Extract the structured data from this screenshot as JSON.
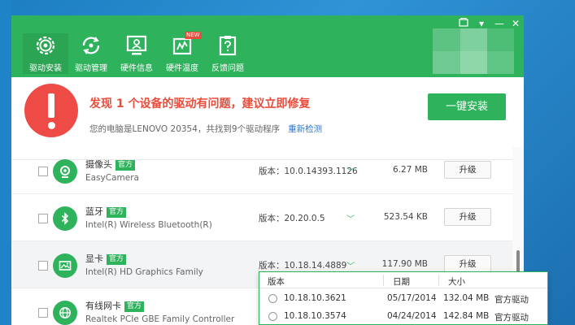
{
  "nav": [
    {
      "label": "驱动安装",
      "icon": "gear-icon"
    },
    {
      "label": "驱动管理",
      "icon": "refresh-icon"
    },
    {
      "label": "硬件信息",
      "icon": "monitor-icon"
    },
    {
      "label": "硬件温度",
      "icon": "thermometer-icon",
      "badge": "NEW"
    },
    {
      "label": "反馈问题",
      "icon": "feedback-icon"
    }
  ],
  "titlebar": {
    "menu_icon": "▾",
    "minimize": "—",
    "close": "✕"
  },
  "alert": {
    "title": "发现 1 个设备的驱动有问题，建议立即修复",
    "subtitle": "您的电脑是LENOVO 20354，共找到9个驱动程序",
    "rescan": "重新检测",
    "install_button": "一键安装"
  },
  "devices": [
    {
      "name": "摄像头",
      "tag": "官方",
      "model": "EasyCamera",
      "version": "版本：10.0.14393.1126",
      "size": "6.27 MB",
      "action": "升级",
      "icon": "camera-icon"
    },
    {
      "name": "蓝牙",
      "tag": "官方",
      "model": "Intel(R) Wireless Bluetooth(R)",
      "version": "版本：20.20.0.5",
      "size": "523.54 KB",
      "action": "升级",
      "icon": "bluetooth-icon"
    },
    {
      "name": "显卡",
      "tag": "官方",
      "model": "Intel(R) HD Graphics Family",
      "version": "版本：10.18.14.4889",
      "size": "117.90 MB",
      "action": "升级",
      "icon": "display-card-icon"
    },
    {
      "name": "有线网卡",
      "tag": "官方",
      "model": "Realtek PCIe GBE Family Controller",
      "version": "",
      "size": "",
      "action": "",
      "icon": "globe-icon"
    }
  ],
  "dropdown": {
    "headers": {
      "version": "版本",
      "date": "日期",
      "size": "大小"
    },
    "rows": [
      {
        "version": "10.18.10.3621",
        "date": "05/17/2014",
        "size": "132.04 MB",
        "source": "官方驱动"
      },
      {
        "version": "10.18.10.3574",
        "date": "04/24/2014",
        "size": "142.84 MB",
        "source": "官方驱动"
      }
    ]
  },
  "colors": {
    "brand_green": "#2fb25c",
    "alert_red": "#ee4a46",
    "link_blue": "#2b7ad6"
  }
}
